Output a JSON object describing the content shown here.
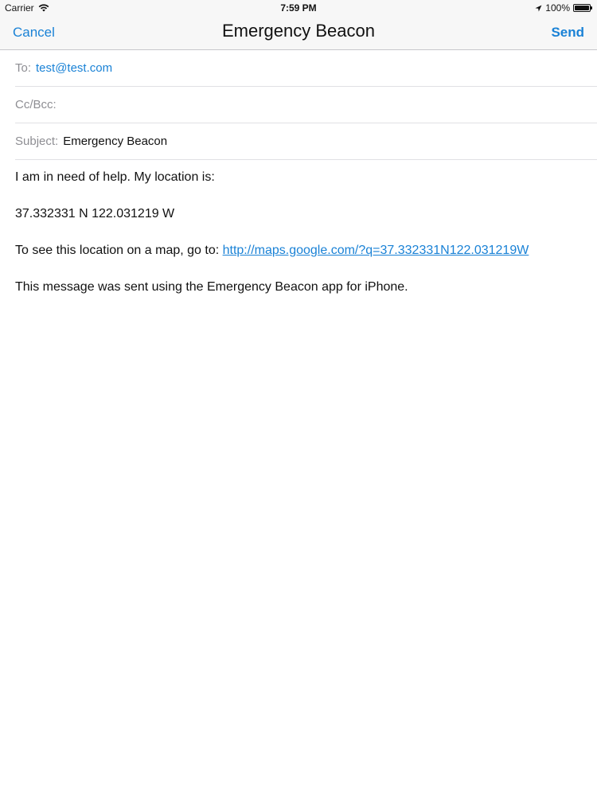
{
  "status_bar": {
    "carrier": "Carrier",
    "time": "7:59 PM",
    "battery": "100%",
    "icons": [
      "wifi-icon",
      "location-icon",
      "battery-icon"
    ]
  },
  "nav": {
    "cancel_label": "Cancel",
    "title": "Emergency Beacon",
    "send_label": "Send"
  },
  "fields": {
    "to_label": "To:",
    "to_value": "test@test.com",
    "cc_label": "Cc/Bcc:",
    "cc_value": "",
    "subject_label": "Subject:",
    "subject_value": "Emergency Beacon"
  },
  "body": {
    "line1": "I am in need of help. My location is:",
    "line2": "37.332331 N 122.031219 W",
    "line3_prefix": "To see this location on a map, go to: ",
    "map_link": "http://maps.google.com/?q=37.332331N122.031219W",
    "line4": "This message was sent using the Emergency Beacon app for iPhone."
  },
  "colors": {
    "accent": "#1a82d6",
    "label_gray": "#8e8e93",
    "bar_background": "#f7f7f7"
  }
}
